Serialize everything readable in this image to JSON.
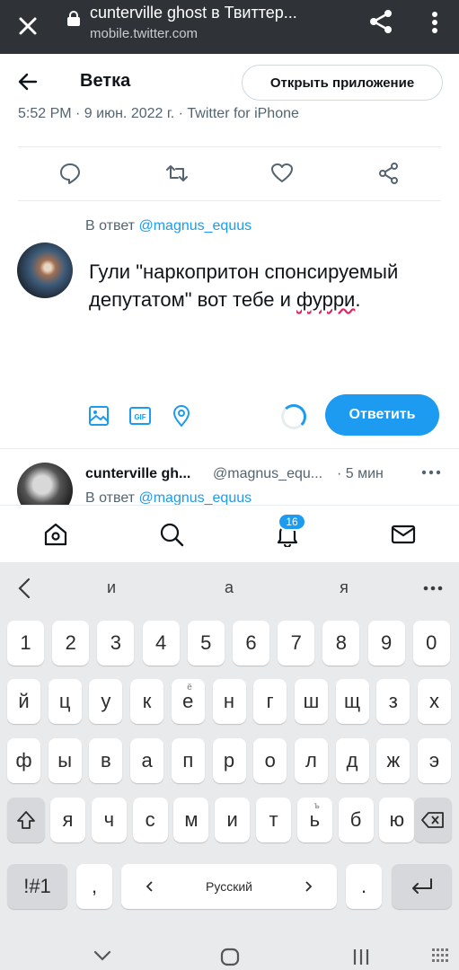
{
  "browser": {
    "title": "cunterville ghost в Твиттер...",
    "url": "mobile.twitter.com"
  },
  "header": {
    "title": "Ветка",
    "open_app_label": "Открыть приложение"
  },
  "tweet_meta": "5:52 PM · 9 июн. 2022 г. · Twitter for iPhone",
  "compose": {
    "reply_prefix": "В ответ",
    "reply_handle": "@magnus_equus",
    "text_before": "Гули \"наркопритон спонсируемый депутатом\" вот тебе и ",
    "text_misspelled": "фурри",
    "text_after": ".",
    "reply_button": "Ответить"
  },
  "next_tweet": {
    "name": "cunterville gh...",
    "handle": "@magnus_equ...",
    "time": "· 5 мин",
    "reply_prefix": "В ответ",
    "reply_handle": "@magnus_equus"
  },
  "nav": {
    "notifications_badge": "16"
  },
  "keyboard": {
    "suggestions": [
      "и",
      "а",
      "я"
    ],
    "row_numbers": [
      "1",
      "2",
      "3",
      "4",
      "5",
      "6",
      "7",
      "8",
      "9",
      "0"
    ],
    "row1": [
      "й",
      "ц",
      "у",
      "к",
      "е",
      "н",
      "г",
      "ш",
      "щ",
      "з",
      "х"
    ],
    "row1_sup": "ё",
    "row2": [
      "ф",
      "ы",
      "в",
      "а",
      "п",
      "р",
      "о",
      "л",
      "д",
      "ж",
      "э"
    ],
    "row3": [
      "я",
      "ч",
      "с",
      "м",
      "и",
      "т",
      "ь",
      "б",
      "ю"
    ],
    "row3_sup": "ъ",
    "symbols_label": "!#1",
    "comma_label": ",",
    "space_label": "Русский",
    "period_label": "."
  },
  "colors": {
    "accent": "#1d9bf0",
    "browser_bar": "#2f3338",
    "keyboard_bg": "#e9eaec"
  }
}
